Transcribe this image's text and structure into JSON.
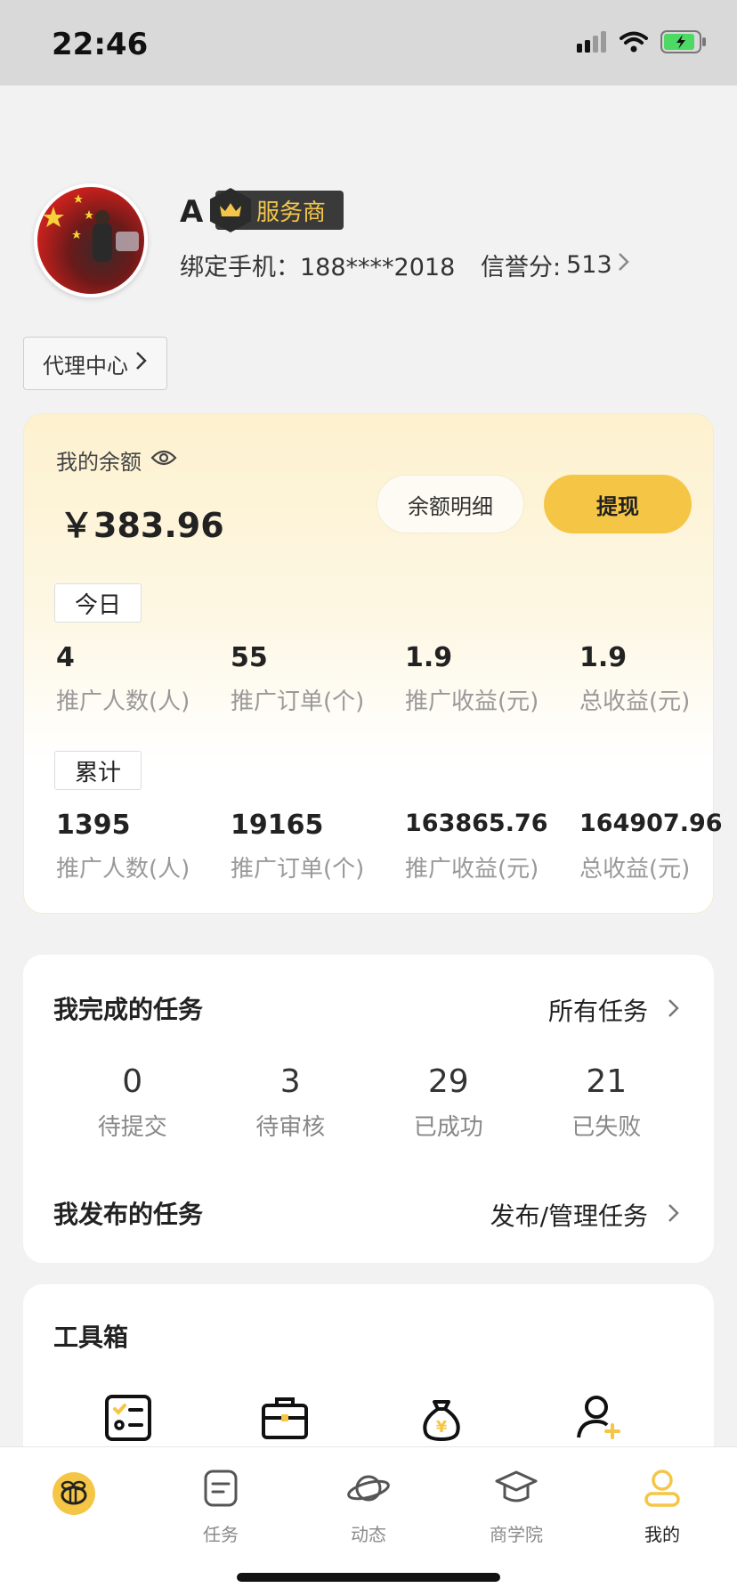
{
  "status_bar": {
    "time": "22:46"
  },
  "profile": {
    "name": "A",
    "badge_label": "服务商",
    "phone_label": "绑定手机：",
    "phone_value": "188****2018",
    "credit_label": "信誉分:",
    "credit_value": "513"
  },
  "agent_center": {
    "label": "代理中心"
  },
  "balance": {
    "title": "我的余额",
    "amount": "￥383.96",
    "detail_button": "余额明细",
    "withdraw_button": "提现"
  },
  "today": {
    "tag": "今日",
    "stats": [
      {
        "value": "4",
        "label": "推广人数(人)"
      },
      {
        "value": "55",
        "label": "推广订单(个)"
      },
      {
        "value": "1.9",
        "label": "推广收益(元)"
      },
      {
        "value": "1.9",
        "label": "总收益(元)"
      }
    ]
  },
  "cumulative": {
    "tag": "累计",
    "stats": [
      {
        "value": "1395",
        "label": "推广人数(人)"
      },
      {
        "value": "19165",
        "label": "推广订单(个)"
      },
      {
        "value": "163865.76",
        "label": "推广收益(元)"
      },
      {
        "value": "164907.96",
        "label": "总收益(元)"
      }
    ]
  },
  "completed_tasks": {
    "title": "我完成的任务",
    "link": "所有任务",
    "stats": [
      {
        "value": "0",
        "label": "待提交"
      },
      {
        "value": "3",
        "label": "待审核"
      },
      {
        "value": "29",
        "label": "已成功"
      },
      {
        "value": "21",
        "label": "已失败"
      }
    ]
  },
  "published_tasks": {
    "title": "我发布的任务",
    "link": "发布/管理任务"
  },
  "toolbox": {
    "title": "工具箱",
    "icons": [
      "checklist-icon",
      "briefcase-icon",
      "money-bag-icon",
      "add-user-icon"
    ]
  },
  "tab_bar": {
    "items": [
      {
        "label": "",
        "icon": "bee-icon"
      },
      {
        "label": "任务",
        "icon": "task-icon"
      },
      {
        "label": "动态",
        "icon": "planet-icon"
      },
      {
        "label": "商学院",
        "icon": "graduation-cap-icon"
      },
      {
        "label": "我的",
        "icon": "user-icon"
      }
    ]
  },
  "colors": {
    "accent": "#F5C645",
    "badge_bg": "#3A3A3A",
    "badge_text": "#F3C64A"
  }
}
